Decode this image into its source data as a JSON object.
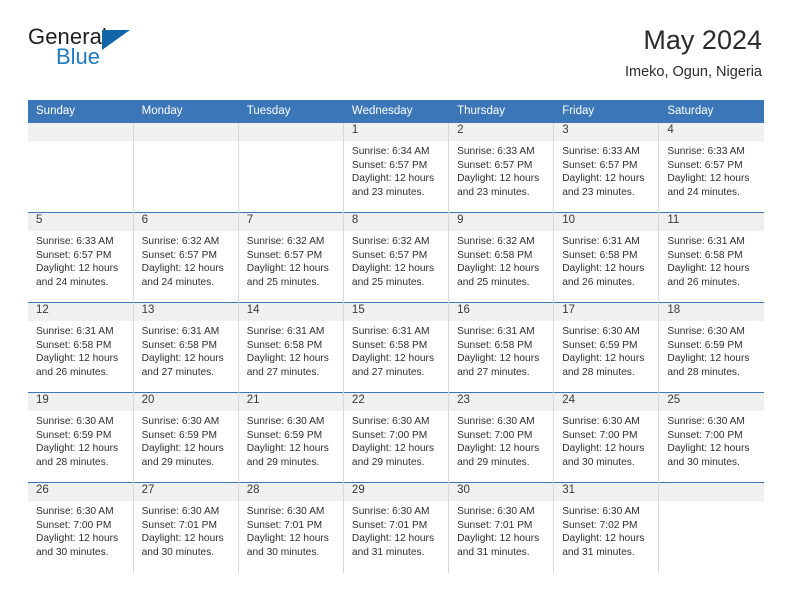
{
  "brand": {
    "name_top": "General",
    "name_bottom": "Blue",
    "triangle_color": "#1065a8",
    "blue_text_color": "#1f7ac4"
  },
  "header": {
    "title": "May 2024",
    "subtitle": "Imeko, Ogun, Nigeria"
  },
  "theme": {
    "header_blue": "#3b77b8",
    "daynum_band": "#f0f0f0",
    "grid_line": "#d8d8d8",
    "text": "#2f2f2f"
  },
  "calendar": {
    "weekday_headers": [
      "Sunday",
      "Monday",
      "Tuesday",
      "Wednesday",
      "Thursday",
      "Friday",
      "Saturday"
    ],
    "labels": {
      "sunrise": "Sunrise:",
      "sunset": "Sunset:",
      "daylight": "Daylight:"
    },
    "weeks": [
      [
        {
          "day": ""
        },
        {
          "day": ""
        },
        {
          "day": ""
        },
        {
          "day": "1",
          "sunrise": "Sunrise: 6:34 AM",
          "sunset": "Sunset: 6:57 PM",
          "daylight1": "Daylight: 12 hours",
          "daylight2": "and 23 minutes."
        },
        {
          "day": "2",
          "sunrise": "Sunrise: 6:33 AM",
          "sunset": "Sunset: 6:57 PM",
          "daylight1": "Daylight: 12 hours",
          "daylight2": "and 23 minutes."
        },
        {
          "day": "3",
          "sunrise": "Sunrise: 6:33 AM",
          "sunset": "Sunset: 6:57 PM",
          "daylight1": "Daylight: 12 hours",
          "daylight2": "and 23 minutes."
        },
        {
          "day": "4",
          "sunrise": "Sunrise: 6:33 AM",
          "sunset": "Sunset: 6:57 PM",
          "daylight1": "Daylight: 12 hours",
          "daylight2": "and 24 minutes."
        }
      ],
      [
        {
          "day": "5",
          "sunrise": "Sunrise: 6:33 AM",
          "sunset": "Sunset: 6:57 PM",
          "daylight1": "Daylight: 12 hours",
          "daylight2": "and 24 minutes."
        },
        {
          "day": "6",
          "sunrise": "Sunrise: 6:32 AM",
          "sunset": "Sunset: 6:57 PM",
          "daylight1": "Daylight: 12 hours",
          "daylight2": "and 24 minutes."
        },
        {
          "day": "7",
          "sunrise": "Sunrise: 6:32 AM",
          "sunset": "Sunset: 6:57 PM",
          "daylight1": "Daylight: 12 hours",
          "daylight2": "and 25 minutes."
        },
        {
          "day": "8",
          "sunrise": "Sunrise: 6:32 AM",
          "sunset": "Sunset: 6:57 PM",
          "daylight1": "Daylight: 12 hours",
          "daylight2": "and 25 minutes."
        },
        {
          "day": "9",
          "sunrise": "Sunrise: 6:32 AM",
          "sunset": "Sunset: 6:58 PM",
          "daylight1": "Daylight: 12 hours",
          "daylight2": "and 25 minutes."
        },
        {
          "day": "10",
          "sunrise": "Sunrise: 6:31 AM",
          "sunset": "Sunset: 6:58 PM",
          "daylight1": "Daylight: 12 hours",
          "daylight2": "and 26 minutes."
        },
        {
          "day": "11",
          "sunrise": "Sunrise: 6:31 AM",
          "sunset": "Sunset: 6:58 PM",
          "daylight1": "Daylight: 12 hours",
          "daylight2": "and 26 minutes."
        }
      ],
      [
        {
          "day": "12",
          "sunrise": "Sunrise: 6:31 AM",
          "sunset": "Sunset: 6:58 PM",
          "daylight1": "Daylight: 12 hours",
          "daylight2": "and 26 minutes."
        },
        {
          "day": "13",
          "sunrise": "Sunrise: 6:31 AM",
          "sunset": "Sunset: 6:58 PM",
          "daylight1": "Daylight: 12 hours",
          "daylight2": "and 27 minutes."
        },
        {
          "day": "14",
          "sunrise": "Sunrise: 6:31 AM",
          "sunset": "Sunset: 6:58 PM",
          "daylight1": "Daylight: 12 hours",
          "daylight2": "and 27 minutes."
        },
        {
          "day": "15",
          "sunrise": "Sunrise: 6:31 AM",
          "sunset": "Sunset: 6:58 PM",
          "daylight1": "Daylight: 12 hours",
          "daylight2": "and 27 minutes."
        },
        {
          "day": "16",
          "sunrise": "Sunrise: 6:31 AM",
          "sunset": "Sunset: 6:58 PM",
          "daylight1": "Daylight: 12 hours",
          "daylight2": "and 27 minutes."
        },
        {
          "day": "17",
          "sunrise": "Sunrise: 6:30 AM",
          "sunset": "Sunset: 6:59 PM",
          "daylight1": "Daylight: 12 hours",
          "daylight2": "and 28 minutes."
        },
        {
          "day": "18",
          "sunrise": "Sunrise: 6:30 AM",
          "sunset": "Sunset: 6:59 PM",
          "daylight1": "Daylight: 12 hours",
          "daylight2": "and 28 minutes."
        }
      ],
      [
        {
          "day": "19",
          "sunrise": "Sunrise: 6:30 AM",
          "sunset": "Sunset: 6:59 PM",
          "daylight1": "Daylight: 12 hours",
          "daylight2": "and 28 minutes."
        },
        {
          "day": "20",
          "sunrise": "Sunrise: 6:30 AM",
          "sunset": "Sunset: 6:59 PM",
          "daylight1": "Daylight: 12 hours",
          "daylight2": "and 29 minutes."
        },
        {
          "day": "21",
          "sunrise": "Sunrise: 6:30 AM",
          "sunset": "Sunset: 6:59 PM",
          "daylight1": "Daylight: 12 hours",
          "daylight2": "and 29 minutes."
        },
        {
          "day": "22",
          "sunrise": "Sunrise: 6:30 AM",
          "sunset": "Sunset: 7:00 PM",
          "daylight1": "Daylight: 12 hours",
          "daylight2": "and 29 minutes."
        },
        {
          "day": "23",
          "sunrise": "Sunrise: 6:30 AM",
          "sunset": "Sunset: 7:00 PM",
          "daylight1": "Daylight: 12 hours",
          "daylight2": "and 29 minutes."
        },
        {
          "day": "24",
          "sunrise": "Sunrise: 6:30 AM",
          "sunset": "Sunset: 7:00 PM",
          "daylight1": "Daylight: 12 hours",
          "daylight2": "and 30 minutes."
        },
        {
          "day": "25",
          "sunrise": "Sunrise: 6:30 AM",
          "sunset": "Sunset: 7:00 PM",
          "daylight1": "Daylight: 12 hours",
          "daylight2": "and 30 minutes."
        }
      ],
      [
        {
          "day": "26",
          "sunrise": "Sunrise: 6:30 AM",
          "sunset": "Sunset: 7:00 PM",
          "daylight1": "Daylight: 12 hours",
          "daylight2": "and 30 minutes."
        },
        {
          "day": "27",
          "sunrise": "Sunrise: 6:30 AM",
          "sunset": "Sunset: 7:01 PM",
          "daylight1": "Daylight: 12 hours",
          "daylight2": "and 30 minutes."
        },
        {
          "day": "28",
          "sunrise": "Sunrise: 6:30 AM",
          "sunset": "Sunset: 7:01 PM",
          "daylight1": "Daylight: 12 hours",
          "daylight2": "and 30 minutes."
        },
        {
          "day": "29",
          "sunrise": "Sunrise: 6:30 AM",
          "sunset": "Sunset: 7:01 PM",
          "daylight1": "Daylight: 12 hours",
          "daylight2": "and 31 minutes."
        },
        {
          "day": "30",
          "sunrise": "Sunrise: 6:30 AM",
          "sunset": "Sunset: 7:01 PM",
          "daylight1": "Daylight: 12 hours",
          "daylight2": "and 31 minutes."
        },
        {
          "day": "31",
          "sunrise": "Sunrise: 6:30 AM",
          "sunset": "Sunset: 7:02 PM",
          "daylight1": "Daylight: 12 hours",
          "daylight2": "and 31 minutes."
        },
        {
          "day": ""
        }
      ]
    ]
  }
}
